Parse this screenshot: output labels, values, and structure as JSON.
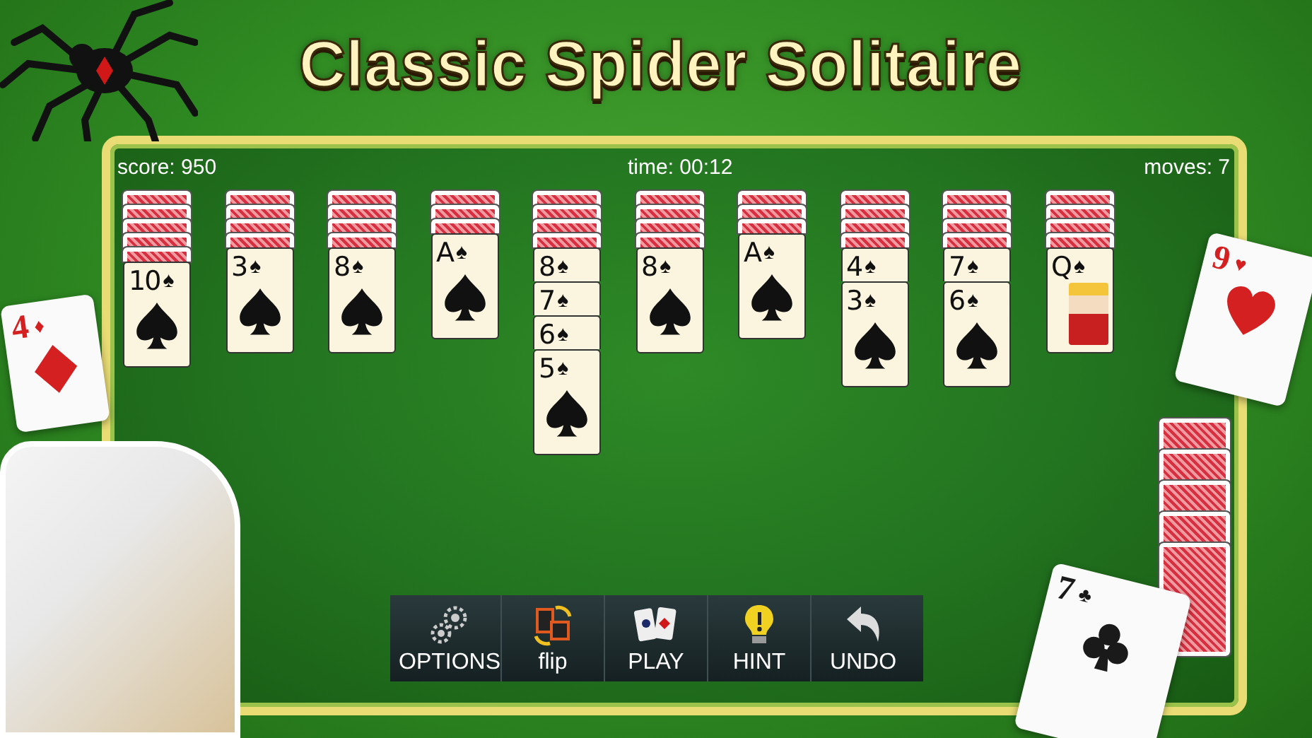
{
  "title": "Classic Spider Solitaire",
  "status": {
    "score": "score: 950",
    "time": "time: 00:12",
    "moves": "moves: 7"
  },
  "columns": [
    {
      "cards": [
        {
          "face_up": false
        },
        {
          "face_up": false
        },
        {
          "face_up": false
        },
        {
          "face_up": false
        },
        {
          "face_up": false
        },
        {
          "face_up": true,
          "kind": "pip",
          "rank": "10",
          "suit": "♠"
        }
      ]
    },
    {
      "cards": [
        {
          "face_up": false
        },
        {
          "face_up": false
        },
        {
          "face_up": false
        },
        {
          "face_up": false
        },
        {
          "face_up": true,
          "kind": "pip",
          "rank": "3",
          "suit": "♠"
        }
      ]
    },
    {
      "cards": [
        {
          "face_up": false
        },
        {
          "face_up": false
        },
        {
          "face_up": false
        },
        {
          "face_up": false
        },
        {
          "face_up": true,
          "kind": "pip",
          "rank": "8",
          "suit": "♠"
        }
      ]
    },
    {
      "cards": [
        {
          "face_up": false
        },
        {
          "face_up": false
        },
        {
          "face_up": false
        },
        {
          "face_up": true,
          "kind": "pip",
          "rank": "A",
          "suit": "♠"
        }
      ]
    },
    {
      "cards": [
        {
          "face_up": false
        },
        {
          "face_up": false
        },
        {
          "face_up": false
        },
        {
          "face_up": false
        },
        {
          "face_up": true,
          "kind": "pip",
          "rank": "8",
          "suit": "♠"
        },
        {
          "face_up": true,
          "kind": "pip",
          "rank": "7",
          "suit": "♠"
        },
        {
          "face_up": true,
          "kind": "pip",
          "rank": "6",
          "suit": "♠"
        },
        {
          "face_up": true,
          "kind": "pip",
          "rank": "5",
          "suit": "♠"
        }
      ]
    },
    {
      "cards": [
        {
          "face_up": false
        },
        {
          "face_up": false
        },
        {
          "face_up": false
        },
        {
          "face_up": false
        },
        {
          "face_up": true,
          "kind": "pip",
          "rank": "8",
          "suit": "♠"
        }
      ]
    },
    {
      "cards": [
        {
          "face_up": false
        },
        {
          "face_up": false
        },
        {
          "face_up": false
        },
        {
          "face_up": true,
          "kind": "pip",
          "rank": "A",
          "suit": "♠"
        }
      ]
    },
    {
      "cards": [
        {
          "face_up": false
        },
        {
          "face_up": false
        },
        {
          "face_up": false
        },
        {
          "face_up": false
        },
        {
          "face_up": true,
          "kind": "pip",
          "rank": "4",
          "suit": "♠"
        },
        {
          "face_up": true,
          "kind": "pip",
          "rank": "3",
          "suit": "♠"
        }
      ]
    },
    {
      "cards": [
        {
          "face_up": false
        },
        {
          "face_up": false
        },
        {
          "face_up": false
        },
        {
          "face_up": false
        },
        {
          "face_up": true,
          "kind": "pip",
          "rank": "7",
          "suit": "♠"
        },
        {
          "face_up": true,
          "kind": "pip",
          "rank": "6",
          "suit": "♠"
        }
      ]
    },
    {
      "cards": [
        {
          "face_up": false
        },
        {
          "face_up": false
        },
        {
          "face_up": false
        },
        {
          "face_up": false
        },
        {
          "face_up": true,
          "kind": "face",
          "rank": "Q",
          "suit": "♠"
        }
      ]
    }
  ],
  "toolbar": [
    {
      "label": "OPTIONS",
      "kind": "options"
    },
    {
      "label": "flip",
      "kind": "flip"
    },
    {
      "label": "PLAY",
      "kind": "play"
    },
    {
      "label": "HINT",
      "kind": "hint"
    },
    {
      "label": "UNDO",
      "kind": "undo"
    }
  ],
  "floating_cards": [
    {
      "rank": "4",
      "suit": "♦",
      "kind": "diamond",
      "color": "#d42020"
    },
    {
      "rank": "9",
      "suit": "♥",
      "kind": "heart",
      "color": "#d42020"
    },
    {
      "rank": "7",
      "suit": "♣",
      "kind": "club",
      "color": "#1a1a1a"
    }
  ]
}
